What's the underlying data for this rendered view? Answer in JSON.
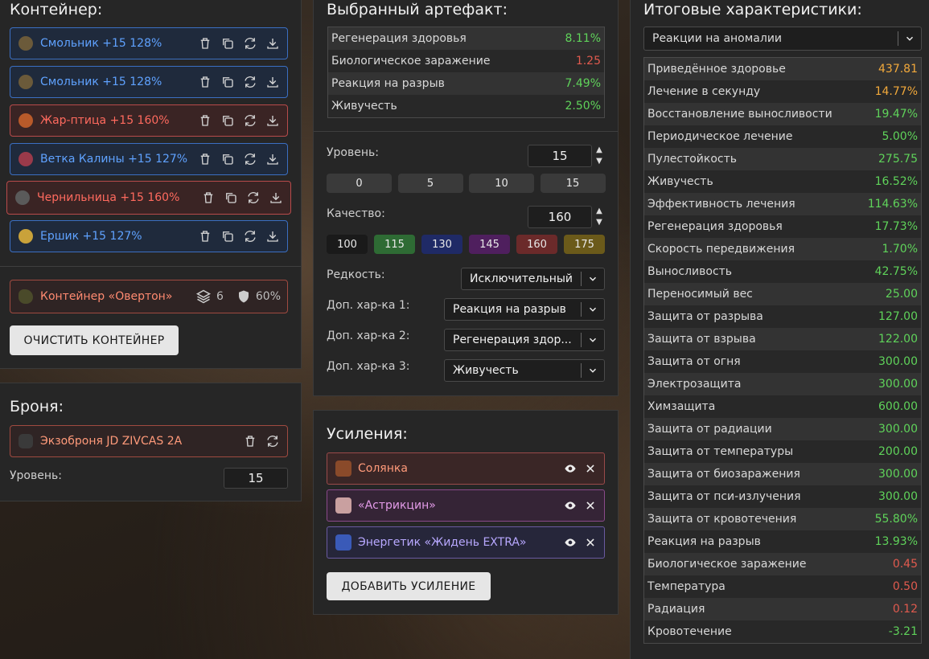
{
  "container": {
    "title": "Контейнер:",
    "items": [
      {
        "label": "Смольник +15 128%",
        "style": "blue",
        "icon": "smolnik-artifact-icon",
        "icon_color": "#6b5a3a"
      },
      {
        "label": "Смольник +15 128%",
        "style": "blue",
        "icon": "smolnik-artifact-icon",
        "icon_color": "#6b5a3a"
      },
      {
        "label": "Жар-птица +15 160%",
        "style": "red",
        "icon": "firebird-artifact-icon",
        "icon_color": "#b85a2a"
      },
      {
        "label": "Ветка Калины +15 127%",
        "style": "blue",
        "icon": "kalina-branch-artifact-icon",
        "icon_color": "#9a3a4a"
      },
      {
        "label": "Чернильница +15 160%",
        "style": "red",
        "icon": "inkwell-artifact-icon",
        "icon_color": "#5a5a5a"
      },
      {
        "label": "Ершик +15 127%",
        "style": "blue",
        "icon": "ershik-artifact-icon",
        "icon_color": "#c9a23a"
      }
    ],
    "container_item": {
      "label": "Контейнер «Овертон»",
      "slots": "6",
      "protection": "60%"
    },
    "clear_button": "ОЧИСТИТЬ КОНТЕЙНЕР"
  },
  "armor": {
    "title": "Броня:",
    "item": "Экзоброня JD ZIVCAS 2A",
    "level_label": "Уровень:",
    "level_value": "15"
  },
  "artifact": {
    "title": "Выбранный артефакт:",
    "stats": [
      {
        "name": "Регенерация здоровья",
        "value": "8.11%",
        "color": "g"
      },
      {
        "name": "Биологическое заражение",
        "value": "1.25",
        "color": "r"
      },
      {
        "name": "Реакция на разрыв",
        "value": "7.49%",
        "color": "g"
      },
      {
        "name": "Живучесть",
        "value": "2.50%",
        "color": "g"
      }
    ],
    "level_label": "Уровень:",
    "level_value": "15",
    "level_presets": [
      "0",
      "5",
      "10",
      "15"
    ],
    "quality_label": "Качество:",
    "quality_value": "160",
    "quality_presets": [
      {
        "label": "100",
        "color": "#1a1a1a"
      },
      {
        "label": "115",
        "color": "#2e6b34"
      },
      {
        "label": "130",
        "color": "#1f2a66"
      },
      {
        "label": "145",
        "color": "#4f1f5e"
      },
      {
        "label": "160",
        "color": "#6b2a2a"
      },
      {
        "label": "175",
        "color": "#6b5a1a"
      }
    ],
    "rarity_label": "Редкость:",
    "rarity_value": "Исключительный",
    "extra1_label": "Доп. хар-ка 1:",
    "extra1_value": "Реакция на разрыв",
    "extra2_label": "Доп. хар-ка 2:",
    "extra2_value": "Регенерация здор...",
    "extra3_label": "Доп. хар-ка 3:",
    "extra3_value": "Живучесть"
  },
  "boosts": {
    "title": "Усиления:",
    "items": [
      {
        "label": "Солянка",
        "bg": "#3a2626",
        "border": "#9a4a4a",
        "color": "#ff9a7a",
        "icon_color": "#8a4a2a"
      },
      {
        "label": "«Астрикцин»",
        "bg": "#352436",
        "border": "#8a4a8a",
        "color": "#e39be8",
        "icon_color": "#c9a0a0"
      },
      {
        "label": "Энергетик «Жидень EXTRA»",
        "bg": "#26263a",
        "border": "#6a5aa0",
        "color": "#b8a8ff",
        "icon_color": "#3a5ab8"
      }
    ],
    "add_button": "ДОБАВИТЬ УСИЛЕНИЕ"
  },
  "totals": {
    "title": "Итоговые характеристики:",
    "filter_value": "Реакции на аномалии",
    "rows": [
      {
        "name": "Приведённое здоровье",
        "value": "437.81",
        "color": "o"
      },
      {
        "name": "Лечение в секунду",
        "value": "14.77%",
        "color": "o"
      },
      {
        "name": "Восстановление выносливости",
        "value": "19.47%",
        "color": "g"
      },
      {
        "name": "Периодическое лечение",
        "value": "5.00%",
        "color": "g"
      },
      {
        "name": "Пулестойкость",
        "value": "275.75",
        "color": "g"
      },
      {
        "name": "Живучесть",
        "value": "16.52%",
        "color": "g"
      },
      {
        "name": "Эффективность лечения",
        "value": "114.63%",
        "color": "g"
      },
      {
        "name": "Регенерация здоровья",
        "value": "17.73%",
        "color": "g"
      },
      {
        "name": "Скорость передвижения",
        "value": "1.70%",
        "color": "g"
      },
      {
        "name": "Выносливость",
        "value": "42.75%",
        "color": "g"
      },
      {
        "name": "Переносимый вес",
        "value": "25.00",
        "color": "g"
      },
      {
        "name": "Защита от разрыва",
        "value": "127.00",
        "color": "g"
      },
      {
        "name": "Защита от взрыва",
        "value": "122.00",
        "color": "g"
      },
      {
        "name": "Защита от огня",
        "value": "300.00",
        "color": "g"
      },
      {
        "name": "Электрозащита",
        "value": "300.00",
        "color": "g"
      },
      {
        "name": "Химзащита",
        "value": "600.00",
        "color": "g"
      },
      {
        "name": "Защита от радиации",
        "value": "300.00",
        "color": "g"
      },
      {
        "name": "Защита от температуры",
        "value": "200.00",
        "color": "g"
      },
      {
        "name": "Защита от биозаражения",
        "value": "300.00",
        "color": "g"
      },
      {
        "name": "Защита от пси-излучения",
        "value": "300.00",
        "color": "g"
      },
      {
        "name": "Защита от кровотечения",
        "value": "55.80%",
        "color": "g"
      },
      {
        "name": "Реакция на разрыв",
        "value": "13.93%",
        "color": "g"
      },
      {
        "name": "Биологическое заражение",
        "value": "0.45",
        "color": "r"
      },
      {
        "name": "Температура",
        "value": "0.50",
        "color": "r"
      },
      {
        "name": "Радиация",
        "value": "0.12",
        "color": "r"
      },
      {
        "name": "Кровотечение",
        "value": "-3.21",
        "color": "g"
      }
    ]
  }
}
